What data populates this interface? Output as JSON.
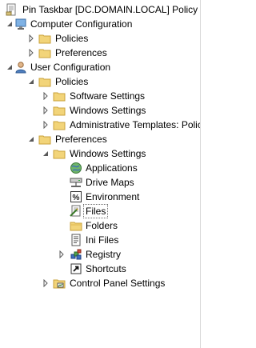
{
  "tree": {
    "root": {
      "label": "Pin Taskbar [DC.DOMAIN.LOCAL] Policy"
    },
    "computer_configuration": {
      "label": "Computer Configuration",
      "policies": "Policies",
      "preferences": "Preferences"
    },
    "user_configuration": {
      "label": "User Configuration",
      "policies": {
        "label": "Policies",
        "software_settings": "Software Settings",
        "windows_settings": "Windows Settings",
        "administrative_templates": "Administrative Templates: Polic"
      },
      "preferences": {
        "label": "Preferences",
        "windows_settings": {
          "label": "Windows Settings",
          "applications": "Applications",
          "drive_maps": "Drive Maps",
          "environment": "Environment",
          "files": "Files",
          "folders": "Folders",
          "ini_files": "Ini Files",
          "registry": "Registry",
          "shortcuts": "Shortcuts"
        },
        "control_panel_settings": "Control Panel Settings"
      }
    },
    "selected_item": "files"
  },
  "icons": {
    "root": "policy-document-icon",
    "computer_configuration": "computer-icon",
    "user_configuration": "user-icon",
    "folder": "folder-icon",
    "applications": "applications-globe-icon",
    "drive_maps": "drive-maps-icon",
    "environment": "environment-icon",
    "files": "files-icon",
    "folders": "folders-icon",
    "ini_files": "ini-files-icon",
    "registry": "registry-icon",
    "shortcuts": "shortcuts-icon",
    "control_panel_settings": "control-panel-icon"
  },
  "colors": {
    "folder_fill": "#f2d479",
    "folder_edge": "#c9a23a",
    "expander": "#595959",
    "selection_border": "#6a6a6a"
  }
}
